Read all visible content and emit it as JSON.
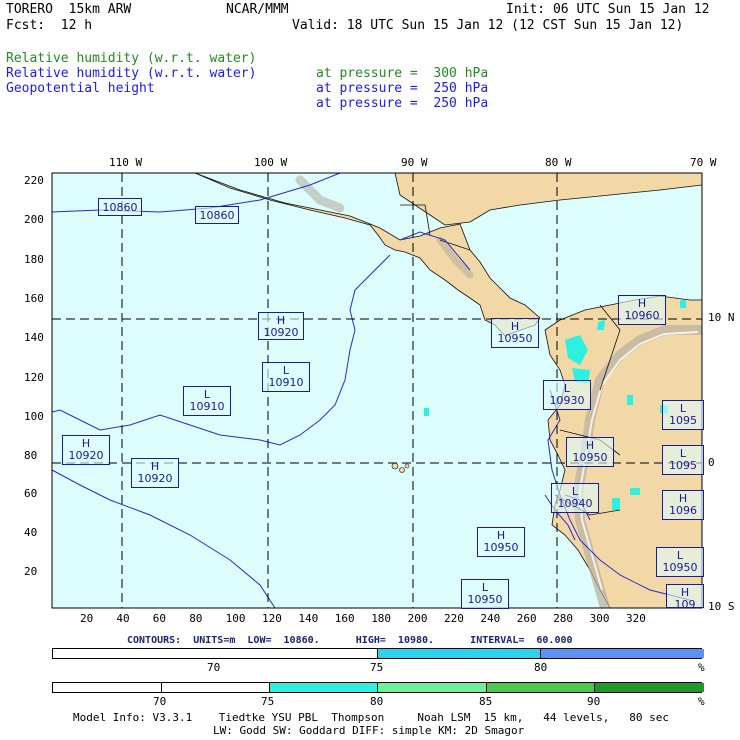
{
  "header": {
    "model": "TORERO  15km ARW",
    "center": "NCAR/MMM",
    "init": "Init: 06 UTC Sun 15 Jan 12",
    "fcst": "Fcst:  12 h",
    "valid": "Valid: 18 UTC Sun 15 Jan 12 (12 CST Sun 15 Jan 12)"
  },
  "fields": [
    {
      "name": "Relative humidity (w.r.t. water)",
      "pressure": "at pressure =  300 hPa",
      "color": "#228b22"
    },
    {
      "name": "Relative humidity (w.r.t. water)",
      "pressure": "at pressure =  250 hPa",
      "color": "#1a1aff"
    },
    {
      "name": "Geopotential height",
      "pressure": "at pressure =  250 hPa",
      "color": "#1a1aff"
    }
  ],
  "map": {
    "lon_labels": [
      "110 W",
      "100 W",
      "90 W",
      "80 W",
      "70 W"
    ],
    "lat_labels": [
      "10 N",
      "0",
      "10 S"
    ],
    "y_ticks": [
      "220",
      "200",
      "180",
      "160",
      "140",
      "120",
      "100",
      "80",
      "60",
      "40",
      "20"
    ],
    "x_ticks": [
      "20",
      "40",
      "60",
      "80",
      "100",
      "120",
      "140",
      "160",
      "180",
      "200",
      "220",
      "240",
      "260",
      "280",
      "300",
      "320"
    ],
    "ocean_color": "#ddfcfc",
    "land_color": "#f2d8a6",
    "contour_boxes": [
      {
        "kind": "",
        "value": "10860"
      },
      {
        "kind": "",
        "value": "10860"
      },
      {
        "kind": "H",
        "value": "10920"
      },
      {
        "kind": "L",
        "value": "10910"
      },
      {
        "kind": "L",
        "value": "10910"
      },
      {
        "kind": "H",
        "value": "10920"
      },
      {
        "kind": "H",
        "value": "10920"
      },
      {
        "kind": "H",
        "value": "10950"
      },
      {
        "kind": "H",
        "value": "10960"
      },
      {
        "kind": "L",
        "value": "10930"
      },
      {
        "kind": "H",
        "value": "10950"
      },
      {
        "kind": "L",
        "value": "10940"
      },
      {
        "kind": "H",
        "value": "10950"
      },
      {
        "kind": "L",
        "value": "10950"
      },
      {
        "kind": "L",
        "value": "1095"
      },
      {
        "kind": "L",
        "value": "1095"
      },
      {
        "kind": "H",
        "value": "1096"
      },
      {
        "kind": "L",
        "value": "10950"
      },
      {
        "kind": "H",
        "value": "109"
      }
    ]
  },
  "contour_info": "CONTOURS:  UNITS=m  LOW=  10860.      HIGH=  10980.      INTERVAL=  60.000",
  "colorbar1": {
    "labels": [
      "70",
      "75",
      "80",
      "%"
    ],
    "colors": [
      "#ffffff",
      "#2ad4f0",
      "#5b93f0"
    ]
  },
  "colorbar2": {
    "labels": [
      "70",
      "75",
      "80",
      "85",
      "90",
      "%"
    ],
    "colors": [
      "#ffffff",
      "#ffffff",
      "#2ef0e0",
      "#6ef09a",
      "#4fc84f",
      "#1f9a2a"
    ]
  },
  "footer": {
    "line1": "Model Info: V3.3.1    Tiedtke YSU PBL  Thompson     Noah LSM  15 km,   44 levels,   80 sec",
    "line2": "LW: Godd SW: Goddard DIFF: simple KM: 2D Smagor"
  }
}
